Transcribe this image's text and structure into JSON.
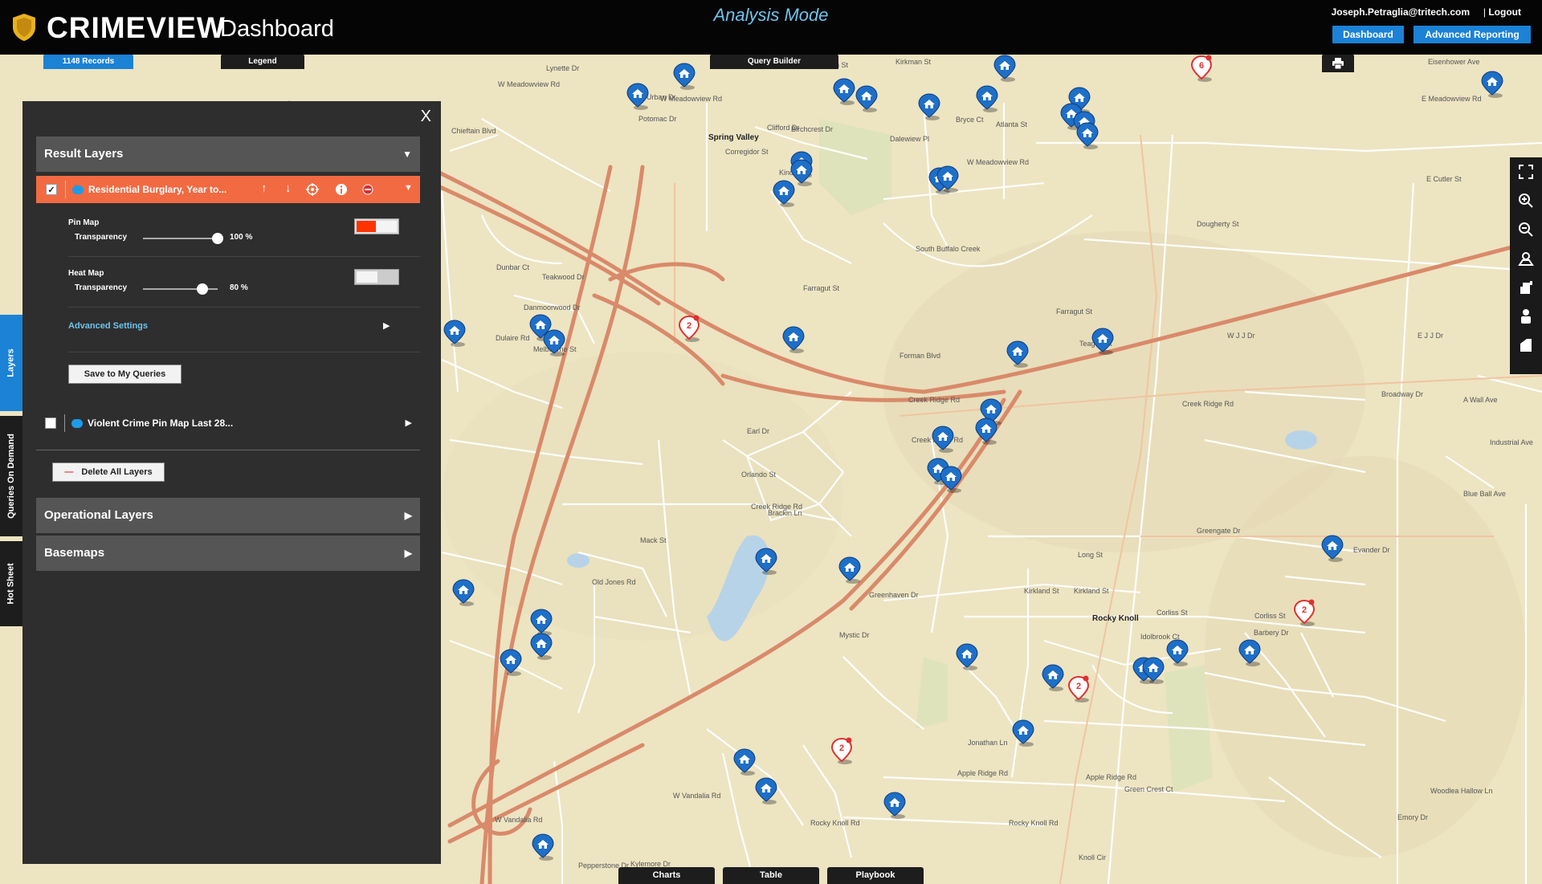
{
  "header": {
    "brand": "CRIMEVIEW",
    "subtitle": "Dashboard",
    "mode": "Analysis Mode",
    "user_email": "Joseph.Petraglia@tritech.com",
    "separator": "|",
    "logout_label": "Logout",
    "dashboard_btn": "Dashboard",
    "advanced_reporting_btn": "Advanced Reporting"
  },
  "map_tabs": {
    "records": "1148 Records",
    "legend": "Legend",
    "query_builder": "Query Builder",
    "print_icon": "print-icon"
  },
  "bottom_tabs": {
    "charts": "Charts",
    "table": "Table",
    "playbook": "Playbook"
  },
  "vertical_tabs": {
    "layers": "Layers",
    "queries_on_demand": "Queries On Demand",
    "hot_sheet": "Hot Sheet"
  },
  "panel": {
    "close": "X",
    "result_layers": "Result Layers",
    "layer1": {
      "name": "Residential Burglary, Year to...",
      "checked": "✓"
    },
    "pin_map": {
      "label": "Pin Map",
      "transparency_label": "Transparency",
      "value": "100 %",
      "fraction": 1.0
    },
    "heat_map": {
      "label": "Heat Map",
      "transparency_label": "Transparency",
      "value": "80 %",
      "fraction": 0.8
    },
    "advanced_settings": "Advanced Settings",
    "save_btn": "Save to My Queries",
    "layer2": {
      "name": "Violent Crime Pin Map Last 28..."
    },
    "delete_btn": "Delete All Layers",
    "operational_layers": "Operational Layers",
    "basemaps": "Basemaps"
  },
  "colors": {
    "accent_blue": "#1b82d6",
    "mode_blue": "#6fc3ec",
    "layer_orange": "#f26a42",
    "pin_blue": "#1e6fc8",
    "cluster_red": "#e03030"
  },
  "map_labels": {
    "streets": [
      "Lynette Dr",
      "Kirkman St",
      "Kirkman St",
      "Eisenhower Ave",
      "W Meadowview Rd",
      "W Meadowview Rd",
      "E Meadowview Rd",
      "Urban Dr",
      "Potomac Dr",
      "Birchcrest Dr",
      "Dalewiew Pl",
      "Bryce Ct",
      "Atlanta St",
      "Chieftain Blvd",
      "Clifford Dr",
      "Corregidor St",
      "Kindley St",
      "W Meadowview Rd",
      "Dougherty St",
      "E Cutler St",
      "South Buffalo Creek",
      "Teakwood Dr",
      "Farragut St",
      "Farragut St",
      "Dunbar Ct",
      "Danmoorwood Dr",
      "Dulaire Rd",
      "Melbourne St",
      "Forman Blvd",
      "Teague St",
      "W J J Dr",
      "E J J Dr",
      "Broadway Dr",
      "A Wall Ave",
      "Creek Ridge Rd",
      "Creek Ridge Rd",
      "Creek Ridge Rd",
      "Earl Dr",
      "Industrial Ave",
      "Creek Ridge Rd",
      "Orlando St",
      "Brackin Ln",
      "Mack St",
      "Long St",
      "Greengate Dr",
      "Evander Dr",
      "Blue Ball Ave",
      "Old Jones Rd",
      "Greenhaven Dr",
      "Kirkland St",
      "Kirkland St",
      "Corliss St",
      "Corliss St",
      "Mystic Dr",
      "Idolbrook Ct",
      "Barbery Dr",
      "Jonathan Ln",
      "Apple Ridge Rd",
      "Apple Ridge Rd",
      "Green Crest Ct",
      "Rocky Knoll Rd",
      "Rocky Knoll Rd",
      "Woodlea Hallow Ln",
      "Emory Dr",
      "Kylemore Dr",
      "Knoll Cir",
      "W Vandalia Rd",
      "W Vandalia Rd",
      "Pepperstone Dr"
    ],
    "places": [
      "Spring Valley",
      "Rocky Knoll"
    ]
  },
  "pins": {
    "blue_count": 46,
    "clusters": [
      "6",
      "2",
      "2",
      "2",
      "2"
    ]
  },
  "toolbar": {
    "icons": [
      "fullscreen-icon",
      "zoom-in-icon",
      "zoom-out-icon",
      "basemap-icon",
      "bookmark-icon",
      "user-icon",
      "layers-icon"
    ]
  }
}
